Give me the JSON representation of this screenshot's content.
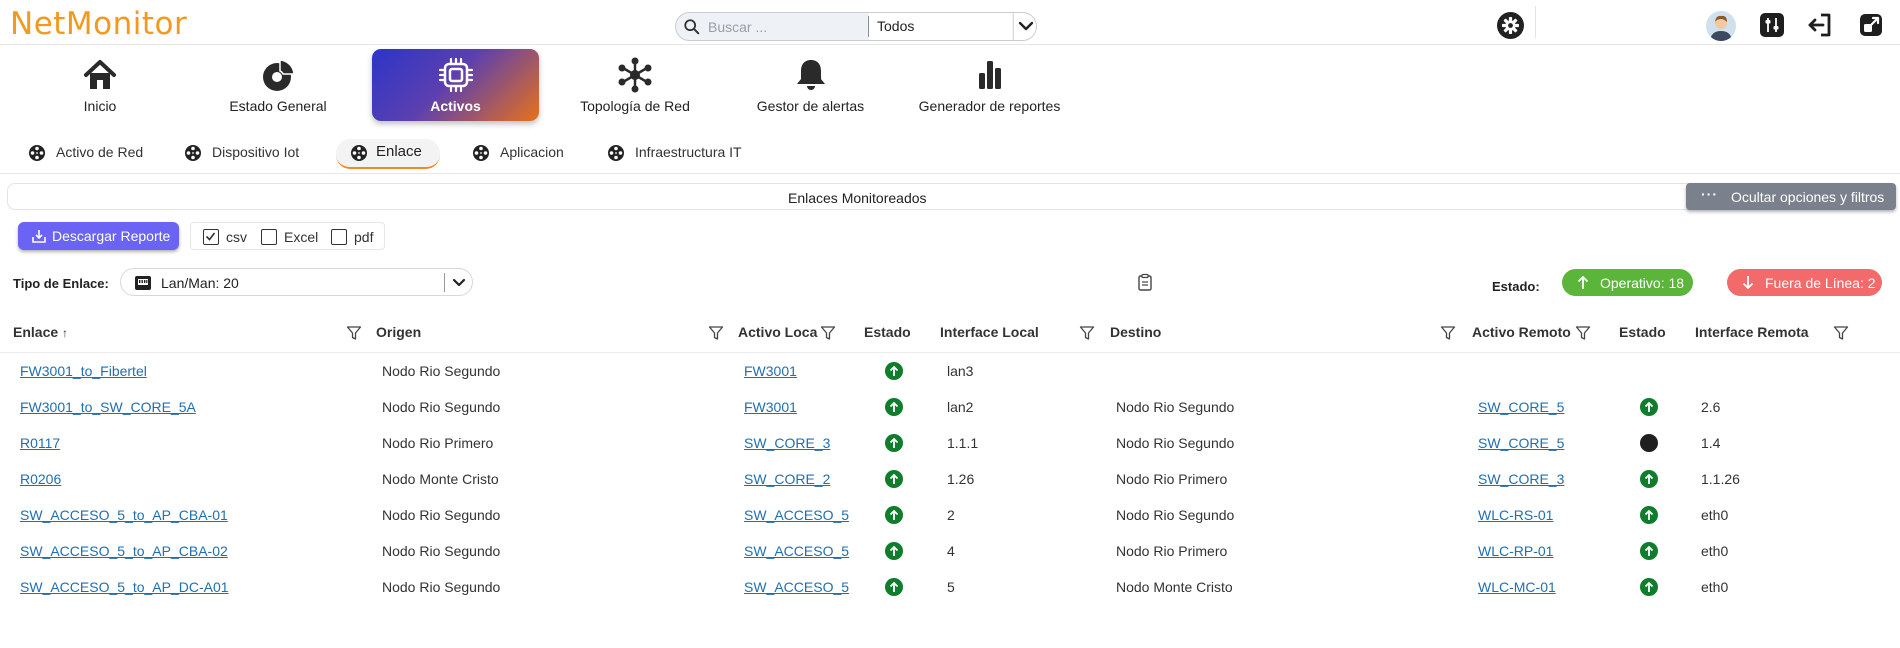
{
  "app": {
    "logo": "NetMonitor"
  },
  "search": {
    "placeholder": "Buscar ...",
    "value": "",
    "scope": "Todos"
  },
  "main_nav": [
    {
      "label": "Inicio",
      "icon": "home-icon",
      "active": false
    },
    {
      "label": "Estado General",
      "icon": "dashboard-icon",
      "active": false
    },
    {
      "label": "Activos",
      "icon": "chip-icon",
      "active": true
    },
    {
      "label": "Topología de Red",
      "icon": "network-icon",
      "active": false
    },
    {
      "label": "Gestor de alertas",
      "icon": "bell-icon",
      "active": false
    },
    {
      "label": "Generador de reportes",
      "icon": "bar-chart-icon",
      "active": false
    }
  ],
  "sub_nav": [
    {
      "label": "Activo de Red",
      "active": false
    },
    {
      "label": "Dispositivo Iot",
      "active": false
    },
    {
      "label": "Enlace",
      "active": true
    },
    {
      "label": "Aplicacion",
      "active": false
    },
    {
      "label": "Infraestructura IT",
      "active": false
    }
  ],
  "section": {
    "title": "Enlaces Monitoreados",
    "toggle_label": "Ocultar opciones y filtros"
  },
  "export": {
    "button_label": "Descargar Reporte",
    "formats": [
      {
        "label": "csv",
        "checked": true
      },
      {
        "label": "Excel",
        "checked": false
      },
      {
        "label": "pdf",
        "checked": false
      }
    ]
  },
  "filters": {
    "tipo_label": "Tipo de Enlace:",
    "tipo_value": "Lan/Man: 20",
    "estado_label": "Estado:",
    "operativo": "Operativo: 18",
    "fuera": "Fuera de Línea: 2"
  },
  "colors": {
    "accent_orange": "#f39a1e",
    "ok_green": "#5bb53a",
    "down_red": "#f26a6a",
    "button_purple": "#6b63f3",
    "link_blue": "#1f6fb2"
  },
  "table": {
    "columns": [
      "Enlace",
      "Origen",
      "Activo Loca",
      "Estado",
      "Interface Local",
      "Destino",
      "Activo Remoto",
      "Estado",
      "Interface Remota"
    ],
    "sort_indicator": "↑",
    "rows": [
      {
        "enlace": "FW3001_to_Fibertel",
        "origen": "Nodo Rio Segundo",
        "activo_local": "FW3001",
        "estado_local": "up",
        "if_local": "lan3",
        "destino": "",
        "activo_remoto": "",
        "estado_remoto": "",
        "if_remota": ""
      },
      {
        "enlace": "FW3001_to_SW_CORE_5A",
        "origen": "Nodo Rio Segundo",
        "activo_local": "FW3001",
        "estado_local": "up",
        "if_local": "lan2",
        "destino": "Nodo Rio Segundo",
        "activo_remoto": "SW_CORE_5",
        "estado_remoto": "up",
        "if_remota": "2.6"
      },
      {
        "enlace": "R0117",
        "origen": "Nodo Rio Primero",
        "activo_local": "SW_CORE_3",
        "estado_local": "up",
        "if_local": "1.1.1",
        "destino": "Nodo Rio Segundo",
        "activo_remoto": "SW_CORE_5",
        "estado_remoto": "off",
        "if_remota": "1.4"
      },
      {
        "enlace": "R0206",
        "origen": "Nodo Monte Cristo",
        "activo_local": "SW_CORE_2",
        "estado_local": "up",
        "if_local": "1.26",
        "destino": "Nodo Rio Primero",
        "activo_remoto": "SW_CORE_3",
        "estado_remoto": "up",
        "if_remota": "1.1.26"
      },
      {
        "enlace": "SW_ACCESO_5_to_AP_CBA-01",
        "origen": "Nodo Rio Segundo",
        "activo_local": "SW_ACCESO_5",
        "estado_local": "up",
        "if_local": "2",
        "destino": "Nodo Rio Segundo",
        "activo_remoto": "WLC-RS-01",
        "estado_remoto": "up",
        "if_remota": "eth0"
      },
      {
        "enlace": "SW_ACCESO_5_to_AP_CBA-02",
        "origen": "Nodo Rio Segundo",
        "activo_local": "SW_ACCESO_5",
        "estado_local": "up",
        "if_local": "4",
        "destino": "Nodo Rio Primero",
        "activo_remoto": "WLC-RP-01",
        "estado_remoto": "up",
        "if_remota": "eth0"
      },
      {
        "enlace": "SW_ACCESO_5_to_AP_DC-A01",
        "origen": "Nodo Rio Segundo",
        "activo_local": "SW_ACCESO_5",
        "estado_local": "up",
        "if_local": "5",
        "destino": "Nodo Monte Cristo",
        "activo_remoto": "WLC-MC-01",
        "estado_remoto": "up",
        "if_remota": "eth0"
      }
    ]
  }
}
